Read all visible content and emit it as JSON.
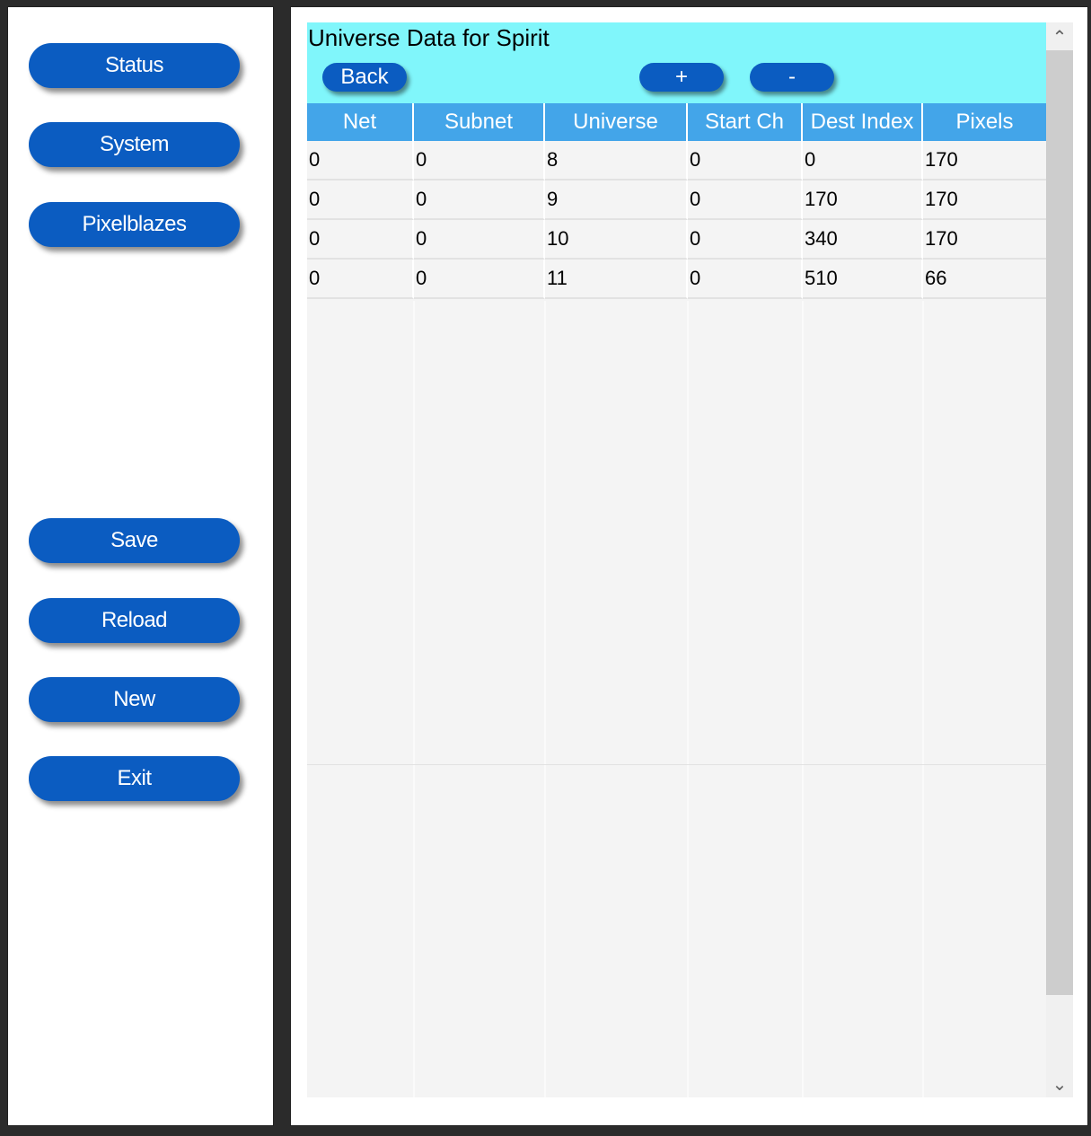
{
  "sidebar": {
    "buttons": [
      {
        "label": "Status"
      },
      {
        "label": "System"
      },
      {
        "label": "Pixelblazes"
      },
      {
        "label": "Save"
      },
      {
        "label": "Reload"
      },
      {
        "label": "New"
      },
      {
        "label": "Exit"
      }
    ]
  },
  "main": {
    "title": "Universe Data for Spirit",
    "back_label": "Back",
    "add_label": "+",
    "remove_label": "-",
    "table": {
      "columns": [
        "Net",
        "Subnet",
        "Universe",
        "Start Ch",
        "Dest Index",
        "Pixels"
      ],
      "rows": [
        [
          "0",
          "0",
          "8",
          "0",
          "0",
          "170"
        ],
        [
          "0",
          "0",
          "9",
          "0",
          "170",
          "170"
        ],
        [
          "0",
          "0",
          "10",
          "0",
          "340",
          "170"
        ],
        [
          "0",
          "0",
          "11",
          "0",
          "510",
          "66"
        ]
      ]
    }
  },
  "scrollbar": {
    "up_icon": "chevron-up-icon",
    "down_icon": "chevron-down-icon"
  },
  "colors": {
    "button_blue": "#0b5cc1",
    "header_band": "#80f6fb",
    "table_header": "#43a5e9",
    "grid_bg": "#f4f4f4",
    "frame": "#2b2b2b"
  }
}
